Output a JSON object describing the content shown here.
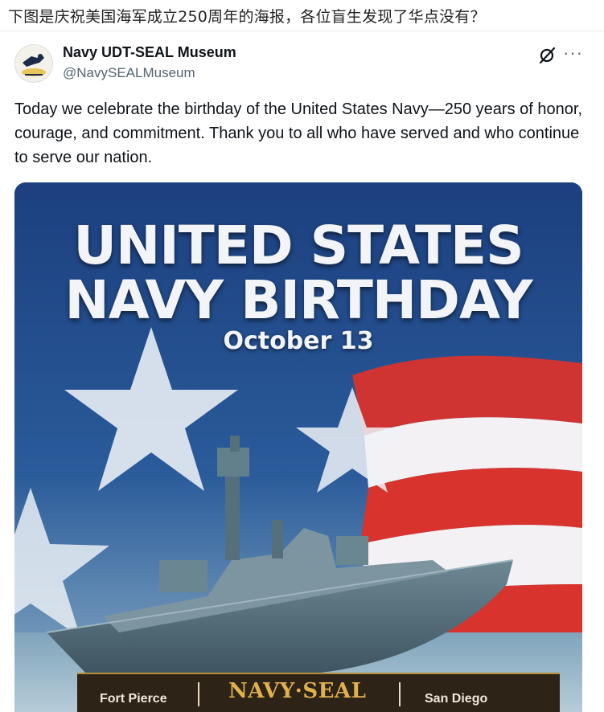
{
  "caption": "下图是庆祝美国海军成立250周年的海报，各位盲生发现了华点没有？",
  "post": {
    "author_name": "Navy UDT-SEAL Museum",
    "author_handle": "@NavySEALMuseum",
    "text": "Today we celebrate the birthday of the United States Navy—250 years of honor, courage, and commitment. Thank you to all who have served and who continue to serve our nation.",
    "icons": [
      "museum-logo-icon",
      "grok-icon",
      "more-options-icon"
    ]
  },
  "poster": {
    "title_line1": "UNITED STATES",
    "title_line2": "NAVY BIRTHDAY",
    "date": "October 13",
    "footer_left": "Fort Pierce",
    "footer_logo": "NAVY·SEAL",
    "footer_right": "San Diego"
  },
  "colors": {
    "poster_blue": "#15346b",
    "flag_red": "#d8332d",
    "ship_gray": "#6f8791",
    "footer_gold": "#e2b04f"
  }
}
